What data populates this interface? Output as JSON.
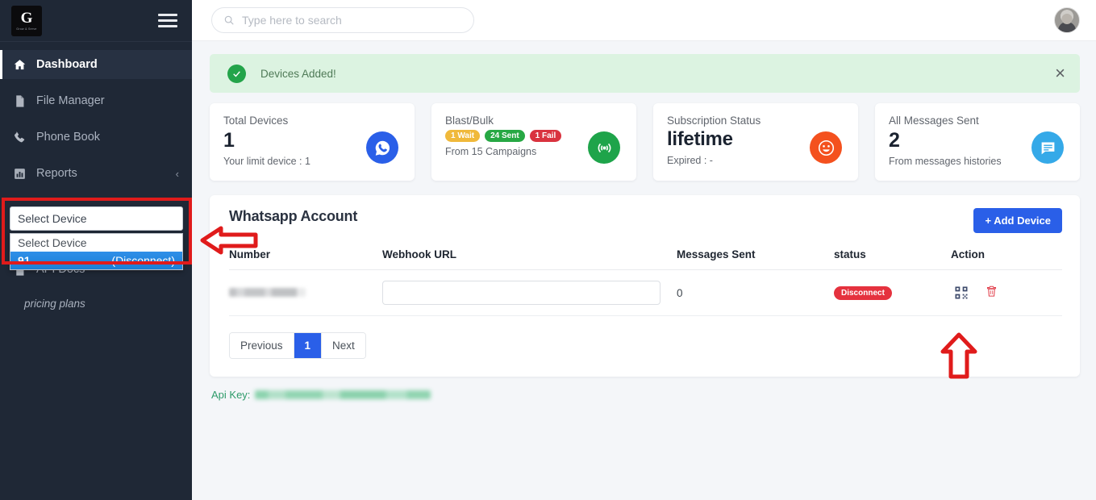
{
  "sidebar": {
    "logo": {
      "letter": "G",
      "subtitle": "Grow & Serve"
    },
    "menu_icon": "hamburger-icon",
    "items": [
      {
        "label": "Dashboard",
        "icon": "home-icon",
        "active": true
      },
      {
        "label": "File Manager",
        "icon": "document-icon",
        "active": false
      },
      {
        "label": "Phone Book",
        "icon": "phone-icon",
        "active": false
      },
      {
        "label": "Reports",
        "icon": "chart-icon",
        "active": false,
        "chevron": "‹"
      }
    ],
    "api_docs_label": "API Docs",
    "pricing_label": "pricing plans",
    "device_select": {
      "value": "Select Device",
      "options": [
        {
          "label": "Select Device",
          "selected": false
        },
        {
          "number": "91",
          "state": "(Disconnect)",
          "selected": true
        }
      ]
    }
  },
  "topbar": {
    "search": {
      "placeholder": "Type here to search",
      "value": "",
      "icon": "search-icon"
    },
    "avatar": "user-avatar"
  },
  "alert": {
    "message": "Devices Added!",
    "icon": "check-circle-icon",
    "close": "×",
    "bg_color": "#dcf3e1",
    "accent_color": "#23a44a"
  },
  "cards": [
    {
      "title": "Total Devices",
      "value": "1",
      "footer": "Your limit device : 1",
      "icon": "whatsapp-icon",
      "icon_color": "#2a5fe8"
    },
    {
      "title": "Blast/Bulk",
      "badges": [
        {
          "text": "1 Wait",
          "color": "#f0b93b"
        },
        {
          "text": "24 Sent",
          "color": "#27a844"
        },
        {
          "text": "1 Fail",
          "color": "#d9333f"
        }
      ],
      "footer": "From 15 Campaigns",
      "icon": "broadcast-icon",
      "icon_color": "#1ea44a"
    },
    {
      "title": "Subscription Status",
      "value": "lifetime",
      "footer": "Expired : -",
      "icon": "smiley-icon",
      "icon_color": "#f4511e"
    },
    {
      "title": "All Messages Sent",
      "value": "2",
      "footer": "From messages histories",
      "icon": "chat-icon",
      "icon_color": "#35a9e8"
    }
  ],
  "panel": {
    "title": "Whatsapp Account",
    "add_device_label": "+  Add Device",
    "table": {
      "headers": [
        "Number",
        "Webhook URL",
        "Messages Sent",
        "status",
        "Action"
      ],
      "rows": [
        {
          "number": "",
          "webhook_value": "",
          "messages_sent": "0",
          "status": "Disconnect",
          "status_color": "#e5323e",
          "actions": [
            "qr-code-icon",
            "trash-icon"
          ]
        }
      ]
    },
    "pagination": {
      "previous": "Previous",
      "pages": [
        "1"
      ],
      "next": "Next",
      "current": "1"
    }
  },
  "api_key": {
    "label": "Api Key:",
    "value": ""
  },
  "annotations": {
    "highlight_color": "#e01b1b",
    "left_arrow": "left-arrow-annotation",
    "up_arrow": "up-arrow-annotation",
    "dropdown_box": "dropdown-highlight-box",
    "qr_box": "qr-highlight-box"
  }
}
